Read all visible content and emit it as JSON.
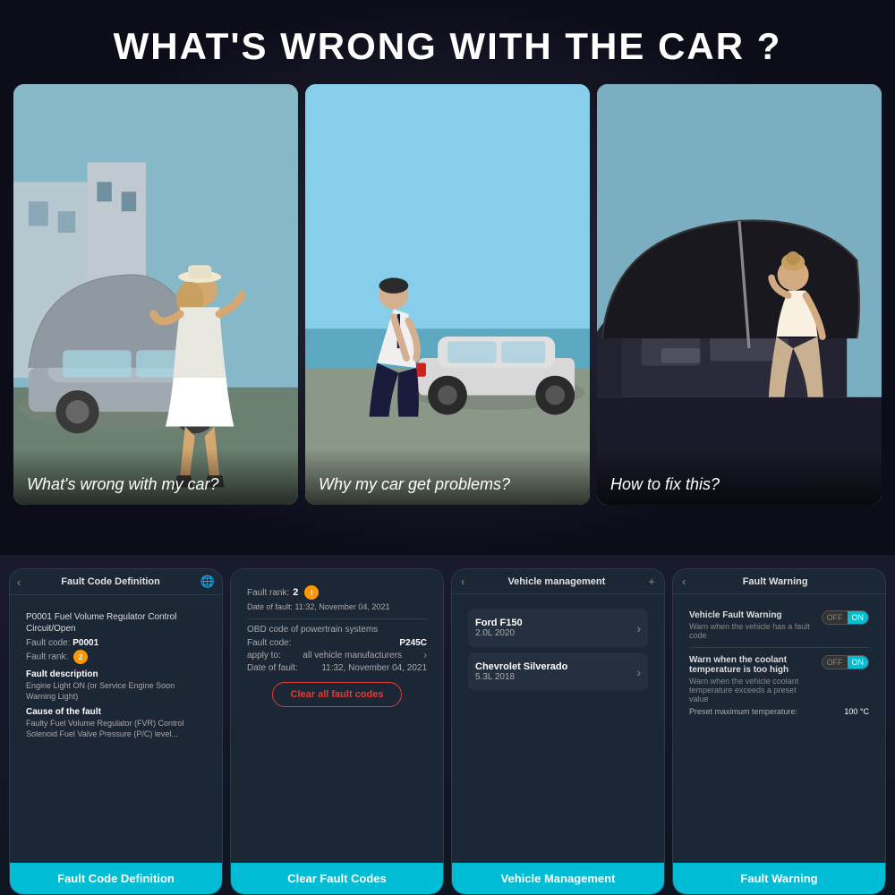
{
  "page": {
    "title": "WHAT'S WRONG WITH THE CAR ?"
  },
  "image_cards": [
    {
      "id": "car-hood",
      "caption": "What's wrong with my car?",
      "bg_color": "#7ba7bc"
    },
    {
      "id": "car-push",
      "caption": "Why my car get problems?",
      "bg_color": "#87ceeb"
    },
    {
      "id": "car-engine",
      "caption": "How to fix this?",
      "bg_color": "#6a9aaa"
    }
  ],
  "app_cards": {
    "fault_code": {
      "header": "Fault Code Definition",
      "fault_title": "P0001 Fuel Volume Regulator Control Circuit/Open",
      "fault_code_label": "Fault code:",
      "fault_code_value": "P0001",
      "fault_rank_label": "Fault rank:",
      "fault_rank_value": "2",
      "fault_desc_header": "Fault description",
      "fault_desc_text": "Engine Light ON (or Service Engine Soon Warning Light)",
      "cause_header": "Cause of the fault",
      "cause_text": "Faulty Fuel Volume Regulator (FVR) Control Solenoid Fuel Valve Pressure (P/C) level...",
      "footer": "Fault Code Definition"
    },
    "clear_fault": {
      "rank_label": "Fault rank:",
      "rank_value": "2",
      "date_label": "Date of fault:",
      "date_value": "11:32, November 04, 2021",
      "obd_label": "OBD code of powertrain systems",
      "fault_code_label": "Fault code:",
      "fault_code_value": "P245C",
      "apply_label": "apply to:",
      "apply_value": "all vehicle manufacturers",
      "date2_label": "Date of fault:",
      "date2_value": "11:32, November 04, 2021",
      "clear_button": "Clear all fault codes",
      "footer": "Clear Fault Codes"
    },
    "vehicle_mgmt": {
      "header": "Vehicle management",
      "vehicle1_name": "Ford F150",
      "vehicle1_detail": "2.0L 2020",
      "vehicle2_name": "Chevrolet Silverado",
      "vehicle2_detail": "5.3L 2018",
      "footer": "Vehicle Management"
    },
    "fault_warning": {
      "header": "Fault Warning",
      "warning1_title": "Vehicle Fault Warning",
      "warning1_subtitle": "Warn when the vehicle has a fault code",
      "toggle1_off": "OFF",
      "toggle1_on": "ON",
      "warning2_title": "Warn when the coolant temperature is too high",
      "warning2_subtitle": "Warn when the vehicle coolant temperature exceeds a preset value",
      "toggle2_off": "OFF",
      "toggle2_on": "ON",
      "preset_label": "Preset maximum temperature:",
      "preset_value": "100 °C",
      "footer": "Fault Warning"
    }
  },
  "colors": {
    "accent": "#00bcd4",
    "warning": "#ff9800",
    "danger": "#e53935",
    "dark_bg": "#1c2735",
    "card_bg": "#1e2a38"
  }
}
